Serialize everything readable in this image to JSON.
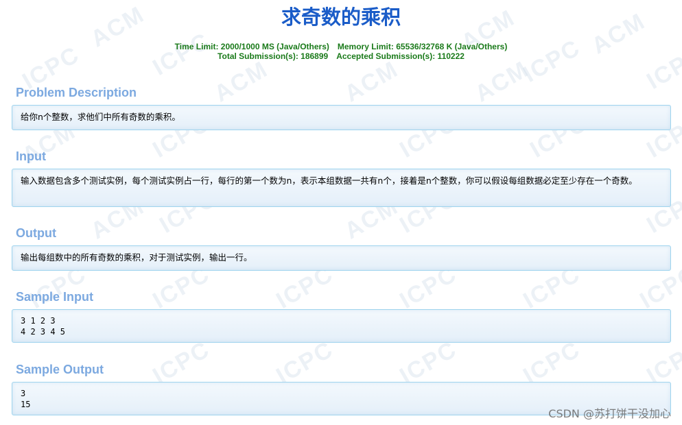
{
  "problem": {
    "title": "求奇数的乘积",
    "limits_line1_left": "Time Limit: 2000/1000 MS (Java/Others)",
    "limits_line1_right": "Memory Limit: 65536/32768 K (Java/Others)",
    "limits_line2_left": "Total Submission(s): 186899",
    "limits_line2_right": "Accepted Submission(s): 110222"
  },
  "sections": {
    "description": {
      "heading": "Problem Description",
      "text": "给你n个整数，求他们中所有奇数的乘积。"
    },
    "input": {
      "heading": "Input",
      "text": "输入数据包含多个测试实例，每个测试实例占一行，每行的第一个数为n，表示本组数据一共有n个，接着是n个整数，你可以假设每组数据必定至少存在一个奇数。"
    },
    "output": {
      "heading": "Output",
      "text": "输出每组数中的所有奇数的乘积，对于测试实例，输出一行。"
    },
    "sample_input": {
      "heading": "Sample Input",
      "text": "3 1 2 3\n4 2 3 4 5"
    },
    "sample_output": {
      "heading": "Sample Output",
      "text": "3\n15"
    }
  },
  "watermark": {
    "text_acm": "ACM",
    "text_icpc": "ICPC",
    "credit": "CSDN @苏打饼干没加心"
  },
  "colors": {
    "title": "#1a5cc8",
    "limits": "#1a7a1a",
    "heading": "#7ca9e0",
    "panel_border": "#9fd4ee"
  }
}
